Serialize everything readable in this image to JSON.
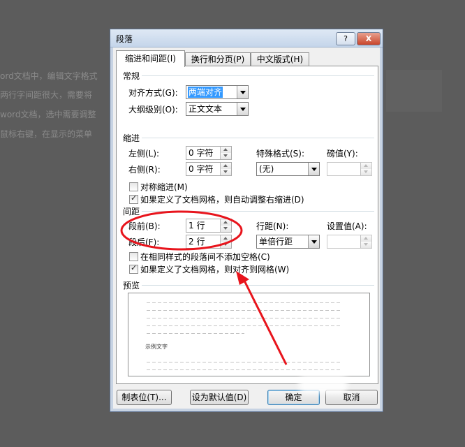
{
  "background": {
    "lines": [
      "ord文档中，编辑文字格式",
      "两行字间距很大，需要将",
      "word文档，选中需要调整",
      "鼠标右键，在显示的菜单"
    ]
  },
  "dialog": {
    "title": "段落",
    "help_button": "?",
    "close_button": "X",
    "tabs": [
      {
        "label": "缩进和间距(I)",
        "active": true
      },
      {
        "label": "换行和分页(P)",
        "active": false
      },
      {
        "label": "中文版式(H)",
        "active": false
      }
    ],
    "general": {
      "heading": "常规",
      "alignment_label": "对齐方式(G):",
      "alignment_value": "两端对齐",
      "outline_label": "大纲级别(O):",
      "outline_value": "正文文本"
    },
    "indent": {
      "heading": "缩进",
      "left_label": "左侧(L):",
      "left_value": "0 字符",
      "right_label": "右侧(R):",
      "right_value": "0 字符",
      "special_label": "特殊格式(S):",
      "special_value": "(无)",
      "by_label": "磅值(Y):",
      "by_value": "",
      "mirror_label": "对称缩进(M)",
      "mirror_checked": false,
      "auto_right_label": "如果定义了文档网格，则自动调整右缩进(D)",
      "auto_right_checked": true
    },
    "spacing": {
      "heading": "间距",
      "before_label": "段前(B):",
      "before_value": "1 行",
      "after_label": "段后(F):",
      "after_value": "2 行",
      "line_label": "行距(N):",
      "line_value": "单倍行距",
      "at_label": "设置值(A):",
      "at_value": "",
      "no_space_label": "在相同样式的段落间不添加空格(C)",
      "no_space_checked": false,
      "snap_grid_label": "如果定义了文档网格，则对齐到网格(W)",
      "snap_grid_checked": true
    },
    "preview": {
      "heading": "预览",
      "sample_text": "示例文字"
    },
    "buttons": {
      "tabs": "制表位(T)...",
      "default": "设为默认值(D)",
      "ok": "确定",
      "cancel": "取消"
    }
  },
  "annotation": {
    "ellipse_color": "#e8141c",
    "arrow_color": "#e8141c"
  }
}
